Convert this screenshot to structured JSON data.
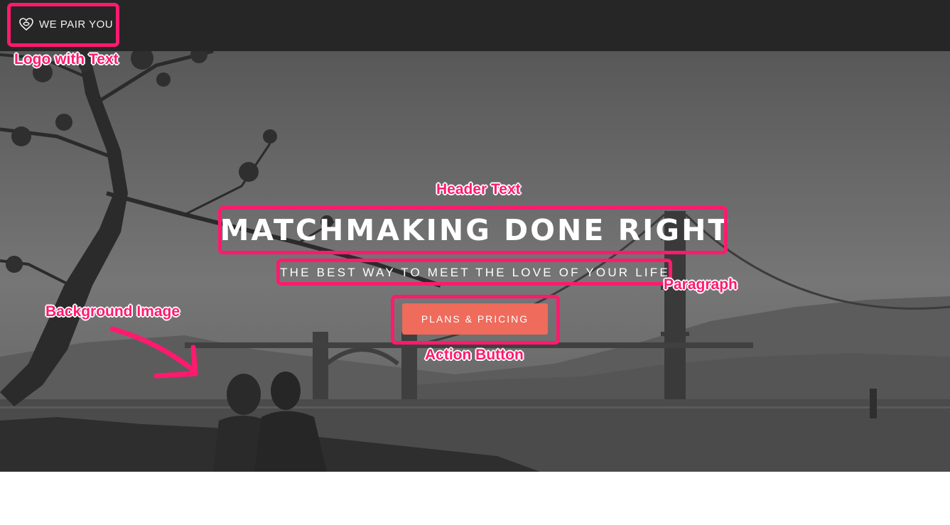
{
  "nav": {
    "logo_text": "WE PAIR YOU"
  },
  "hero": {
    "headline": "MATCHMAKING DONE RIGHT",
    "subheadline": "THE BEST WAY TO MEET THE LOVE OF YOUR LIFE",
    "cta_label": "PLANS & PRICING"
  },
  "annotations": {
    "logo": "Logo with Text",
    "header": "Header Text",
    "paragraph": "Paragraph",
    "background": "Background Image",
    "button": "Action Button"
  },
  "colors": {
    "navbar": "#262626",
    "cta": "#ef6b5b",
    "annotation": "#ff1a6e"
  },
  "icons": {
    "logo": "heart-outline-icon",
    "annotation_arrow": "arrow-icon"
  }
}
